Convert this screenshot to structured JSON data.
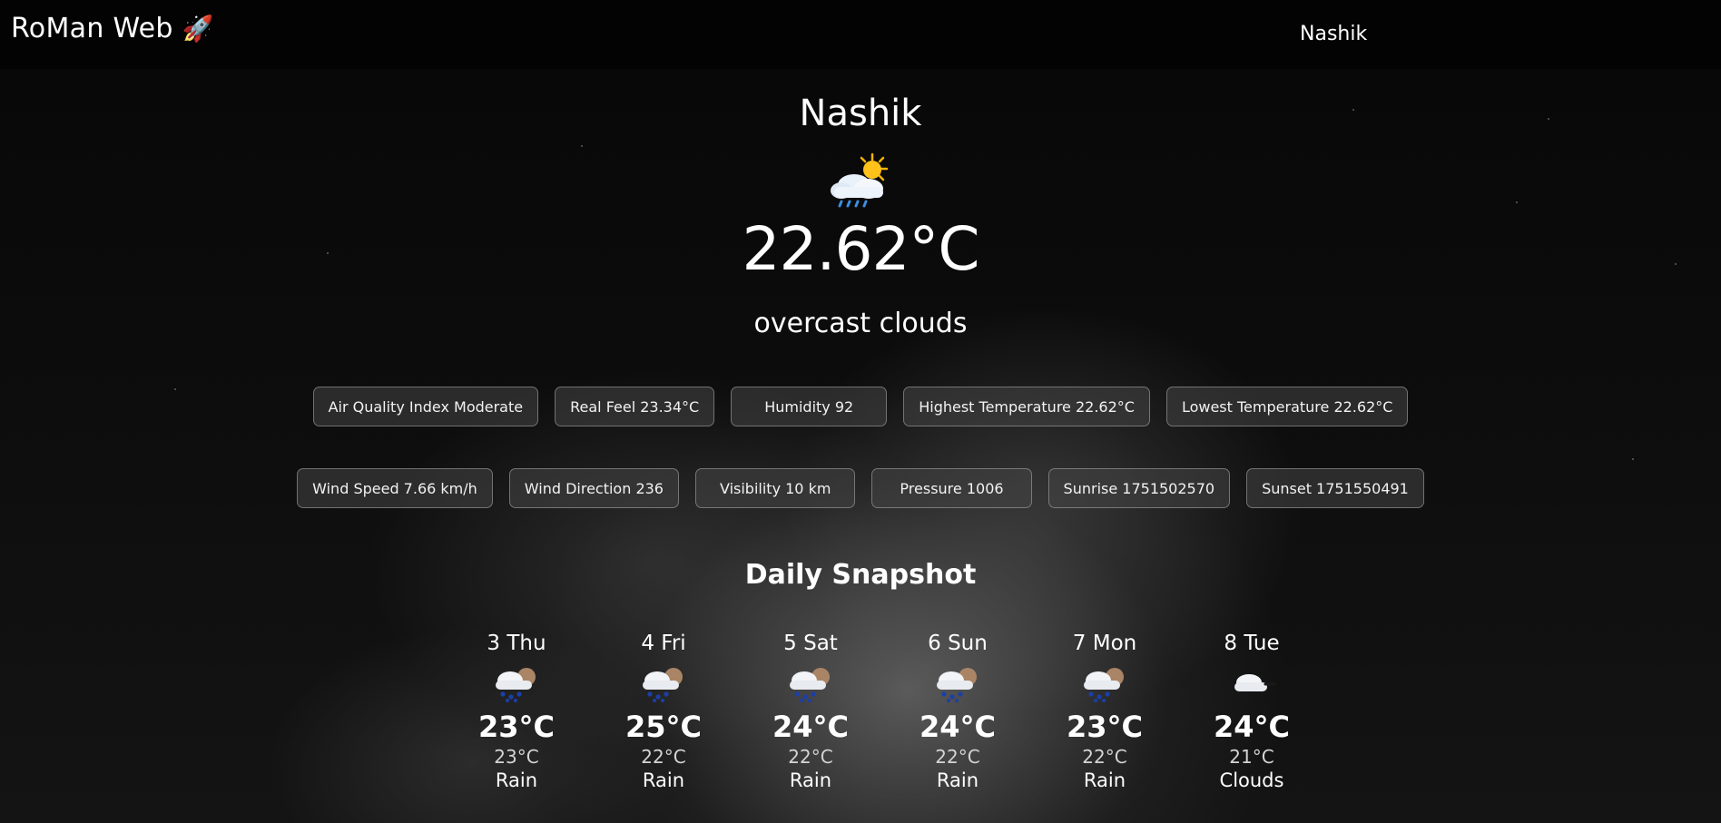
{
  "navbar": {
    "brand": "RoMan Web",
    "brand_icon": "rocket-icon",
    "search_value": "Nashik"
  },
  "current": {
    "city": "Nashik",
    "icon": "sun-behind-rain-cloud-icon",
    "temperature": "22.62°C",
    "description": "overcast clouds"
  },
  "details_row1": [
    "Air Quality Index Moderate",
    "Real Feel 23.34°C",
    "Humidity 92",
    "Highest Temperature 22.62°C",
    "Lowest Temperature 22.62°C"
  ],
  "details_row2": [
    "Wind Speed 7.66 km/h",
    "Wind Direction 236",
    "Visibility 10 km",
    "Pressure 1006",
    "Sunrise 1751502570",
    "Sunset 1751550491"
  ],
  "snapshot": {
    "title": "Daily Snapshot",
    "days": [
      {
        "day": "3 Thu",
        "icon": "rain-icon",
        "max": "23°C",
        "min": "23°C",
        "condition": "Rain"
      },
      {
        "day": "4 Fri",
        "icon": "rain-icon",
        "max": "25°C",
        "min": "22°C",
        "condition": "Rain"
      },
      {
        "day": "5 Sat",
        "icon": "rain-icon",
        "max": "24°C",
        "min": "22°C",
        "condition": "Rain"
      },
      {
        "day": "6 Sun",
        "icon": "rain-icon",
        "max": "24°C",
        "min": "22°C",
        "condition": "Rain"
      },
      {
        "day": "7 Mon",
        "icon": "rain-icon",
        "max": "23°C",
        "min": "22°C",
        "condition": "Rain"
      },
      {
        "day": "8 Tue",
        "icon": "cloud-icon",
        "max": "24°C",
        "min": "21°C",
        "condition": "Clouds"
      }
    ]
  }
}
